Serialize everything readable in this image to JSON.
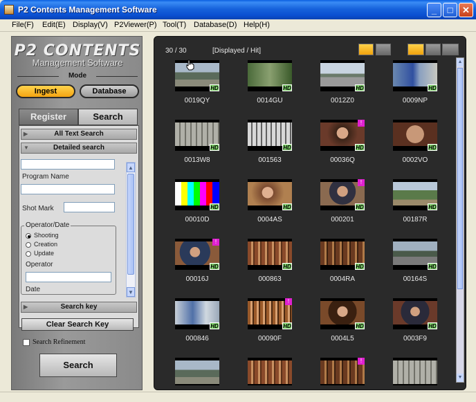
{
  "window": {
    "title": "P2 Contents Management Software",
    "controls": [
      "_",
      "□",
      "✕"
    ]
  },
  "menu": [
    {
      "label": "File(F)"
    },
    {
      "label": "Edit(E)"
    },
    {
      "label": "Display(V)"
    },
    {
      "label": "P2Viewer(P)"
    },
    {
      "label": "Tool(T)"
    },
    {
      "label": "Database(D)"
    },
    {
      "label": "Help(H)"
    }
  ],
  "logo": {
    "line1": "P2 CONTENTS",
    "line2": "Management Software"
  },
  "mode": {
    "label": "Mode",
    "ingest": "Ingest",
    "database": "Database",
    "selected": "Ingest"
  },
  "tabs": {
    "register": "Register",
    "search": "Search",
    "selected": "Search"
  },
  "search": {
    "all_text": "All Text Search",
    "detailed": "Detailed search",
    "top_field": "",
    "program_name_label": "Program Name",
    "program_name": "",
    "shot_mark_label": "Shot Mark",
    "shot_mark": "",
    "operator_date_label": "Operator/Date",
    "radios": [
      {
        "label": "Shooting",
        "checked": true
      },
      {
        "label": "Creation",
        "checked": false
      },
      {
        "label": "Update",
        "checked": false
      }
    ],
    "operator_label": "Operator",
    "operator": "",
    "date_label": "Date",
    "search_key": "Search key",
    "clear_button": "Clear Search Key",
    "refinement_label": "Search Refinement",
    "refinement_checked": false,
    "search_button": "Search"
  },
  "results": {
    "count": "30 / 30",
    "label": "[Displayed / Hit]",
    "clips": [
      {
        "name": "0019QY",
        "hd": true,
        "flag": false,
        "scene": "street"
      },
      {
        "name": "0014GU",
        "hd": true,
        "flag": false,
        "scene": "park"
      },
      {
        "name": "0012Z0",
        "hd": true,
        "flag": false,
        "scene": "road"
      },
      {
        "name": "0009NP",
        "hd": true,
        "flag": false,
        "scene": "sign"
      },
      {
        "name": "0013W8",
        "hd": true,
        "flag": false,
        "scene": "building"
      },
      {
        "name": "001563",
        "hd": true,
        "flag": false,
        "scene": "tower"
      },
      {
        "name": "00036Q",
        "hd": true,
        "flag": true,
        "scene": "woman"
      },
      {
        "name": "0002VO",
        "hd": true,
        "flag": false,
        "scene": "closeup"
      },
      {
        "name": "00010D",
        "hd": true,
        "flag": false,
        "scene": "bars"
      },
      {
        "name": "0004AS",
        "hd": true,
        "flag": false,
        "scene": "woman2"
      },
      {
        "name": "000201",
        "hd": true,
        "flag": true,
        "scene": "man"
      },
      {
        "name": "00187R",
        "hd": true,
        "flag": false,
        "scene": "path"
      },
      {
        "name": "00016J",
        "hd": true,
        "flag": true,
        "scene": "man2"
      },
      {
        "name": "000863",
        "hd": true,
        "flag": false,
        "scene": "shelf"
      },
      {
        "name": "0004RA",
        "hd": true,
        "flag": false,
        "scene": "shelf2"
      },
      {
        "name": "00164S",
        "hd": true,
        "flag": false,
        "scene": "cars"
      },
      {
        "name": "000846",
        "hd": true,
        "flag": false,
        "scene": "sign2"
      },
      {
        "name": "00090F",
        "hd": true,
        "flag": true,
        "scene": "shelf3"
      },
      {
        "name": "0004L5",
        "hd": true,
        "flag": false,
        "scene": "woman3"
      },
      {
        "name": "0003F9",
        "hd": true,
        "flag": false,
        "scene": "man3"
      },
      {
        "name": "",
        "hd": false,
        "flag": false,
        "scene": "street"
      },
      {
        "name": "",
        "hd": false,
        "flag": false,
        "scene": "shelf"
      },
      {
        "name": "",
        "hd": false,
        "flag": true,
        "scene": "shelf2"
      },
      {
        "name": "",
        "hd": false,
        "flag": false,
        "scene": "building"
      }
    ]
  },
  "colors": {
    "accent": "#f3a411",
    "hd_badge": "#7fd36a",
    "flag": "#e020d0",
    "panel": "#2a2a2a"
  }
}
